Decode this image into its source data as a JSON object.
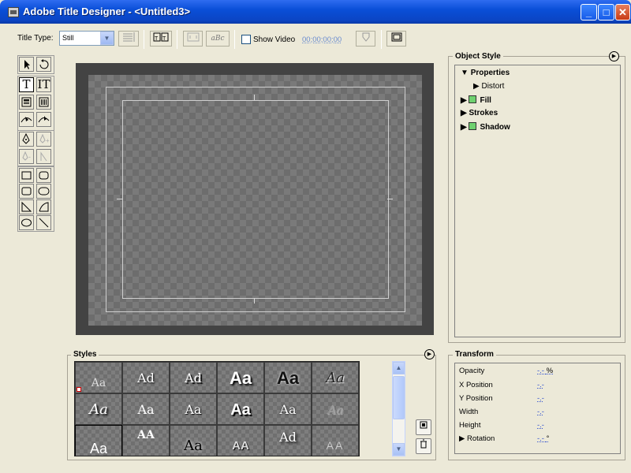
{
  "window": {
    "title": "Adobe Title Designer - <Untitled3>",
    "minimize": "_",
    "maximize": "□",
    "close": "✕"
  },
  "toolbar": {
    "title_type_label": "Title Type:",
    "title_type_value": "Still",
    "show_video_label": "Show Video",
    "timecode": "00;00;00;00"
  },
  "tools": [
    "selection",
    "rotation",
    "type",
    "vertical-type",
    "area-type",
    "vertical-area-type",
    "path-type",
    "vertical-path-type",
    "pen",
    "add-anchor-point",
    "delete-anchor-point",
    "convert-anchor-point",
    "rectangle",
    "rounded-corner-rectangle",
    "clipped-corner-rectangle",
    "rounded-rectangle",
    "wedge",
    "arc",
    "ellipse",
    "line"
  ],
  "object_style": {
    "title": "Object Style",
    "items": [
      {
        "label": "Properties",
        "expanded": true
      },
      {
        "label": "Distort"
      },
      {
        "label": "Fill",
        "swatch_color": "#6fd16f"
      },
      {
        "label": "Strokes"
      },
      {
        "label": "Shadow",
        "swatch_color": "#6fd16f"
      }
    ]
  },
  "styles": {
    "title": "Styles",
    "swatches": [
      "Aa",
      "Ad",
      "Ad",
      "Aa",
      "Aa",
      "Aa",
      "Aa",
      "Aa",
      "Aa",
      "Aa",
      "Aa",
      "Aa",
      "Aa",
      "AA",
      "Aa",
      "AA",
      "Ad",
      "AA"
    ]
  },
  "transform": {
    "title": "Transform",
    "rows": [
      {
        "label": "Opacity",
        "value": "-.-",
        "unit": "%"
      },
      {
        "label": "X Position",
        "value": "-.-",
        "unit": ""
      },
      {
        "label": "Y Position",
        "value": "-.-",
        "unit": ""
      },
      {
        "label": "Width",
        "value": "-.-",
        "unit": ""
      },
      {
        "label": "Height",
        "value": "-.-",
        "unit": ""
      },
      {
        "label": "Rotation",
        "value": "-.-",
        "unit": "°"
      }
    ]
  }
}
